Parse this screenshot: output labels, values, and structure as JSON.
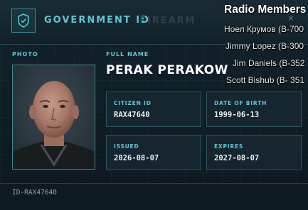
{
  "header": {
    "title": "GOVERNMENT ID",
    "inactive_tab": "FIREARM",
    "badge_icon": "shield-check-icon",
    "close_symbol": "×"
  },
  "photo": {
    "label": "PHOTO"
  },
  "person": {
    "full_name_label": "FULL NAME",
    "full_name": "PERAK PERAKOW"
  },
  "fields": {
    "citizen_id": {
      "label": "CITIZEN ID",
      "value": "RAX47640"
    },
    "date_of_birth": {
      "label": "DATE OF BIRTH",
      "value": "1999-06-13"
    },
    "issued": {
      "label": "ISSUED",
      "value": "2026-08-07"
    },
    "expires": {
      "label": "EXPIRES",
      "value": "2027-08-07"
    }
  },
  "footer": {
    "id_text": "ID-RAX47640"
  },
  "radio": {
    "title": "Radio Members",
    "members": [
      "Ноел Крумов (B-700",
      "Jimmy Lopez (B-300",
      "Jim Daniels (B-352",
      "Scott Bishub (B- 351"
    ]
  },
  "colors": {
    "accent": "#5fc7cf",
    "background": "#0e1a22",
    "border": "#2f5661"
  }
}
